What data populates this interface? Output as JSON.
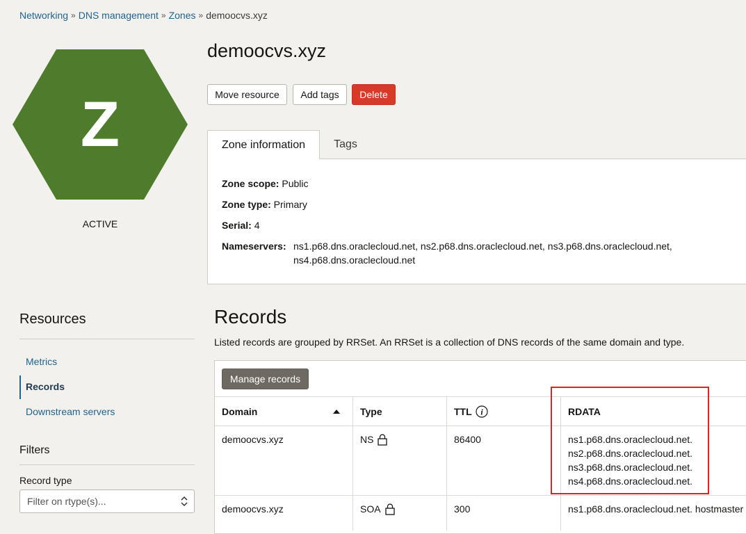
{
  "breadcrumb": {
    "items": [
      "Networking",
      "DNS management",
      "Zones"
    ],
    "current": "demoocvs.xyz"
  },
  "zone": {
    "icon_letter": "Z",
    "icon_color": "#4e7c2c",
    "status": "ACTIVE",
    "name": "demoocvs.xyz"
  },
  "actions": {
    "move_resource": "Move resource",
    "add_tags": "Add tags",
    "delete": "Delete"
  },
  "tabs": {
    "zone_information": "Zone information",
    "tags": "Tags"
  },
  "info": {
    "zone_scope_label": "Zone scope:",
    "zone_scope_value": "Public",
    "zone_type_label": "Zone type:",
    "zone_type_value": "Primary",
    "serial_label": "Serial:",
    "serial_value": "4",
    "nameservers_label": "Nameservers:",
    "nameservers_line1": "ns1.p68.dns.oraclecloud.net, ns2.p68.dns.oraclecloud.net, ns3.p68.dns.oraclecloud.net,",
    "nameservers_line2": "ns4.p68.dns.oraclecloud.net"
  },
  "resources": {
    "title": "Resources",
    "items": [
      "Metrics",
      "Records",
      "Downstream servers"
    ],
    "active": "Records"
  },
  "filters": {
    "title": "Filters",
    "record_type_label": "Record type",
    "record_type_placeholder": "Filter on rtype(s)..."
  },
  "records": {
    "title": "Records",
    "description": "Listed records are grouped by RRSet. An RRSet is a collection of DNS records of the same domain and type.",
    "manage_button": "Manage records",
    "columns": {
      "domain": "Domain",
      "type": "Type",
      "ttl": "TTL",
      "rdata": "RDATA"
    },
    "rows": [
      {
        "domain": "demoocvs.xyz",
        "type": "NS",
        "ttl": "86400",
        "rdata": [
          "ns1.p68.dns.oraclecloud.net.",
          "ns2.p68.dns.oraclecloud.net.",
          "ns3.p68.dns.oraclecloud.net.",
          "ns4.p68.dns.oraclecloud.net."
        ]
      },
      {
        "domain": "demoocvs.xyz",
        "type": "SOA",
        "ttl": "300",
        "rdata": [
          "ns1.p68.dns.oraclecloud.net. hostmaster"
        ]
      }
    ]
  },
  "colors": {
    "link": "#1f6390",
    "danger": "#d73b28",
    "highlight": "#d9242a"
  }
}
